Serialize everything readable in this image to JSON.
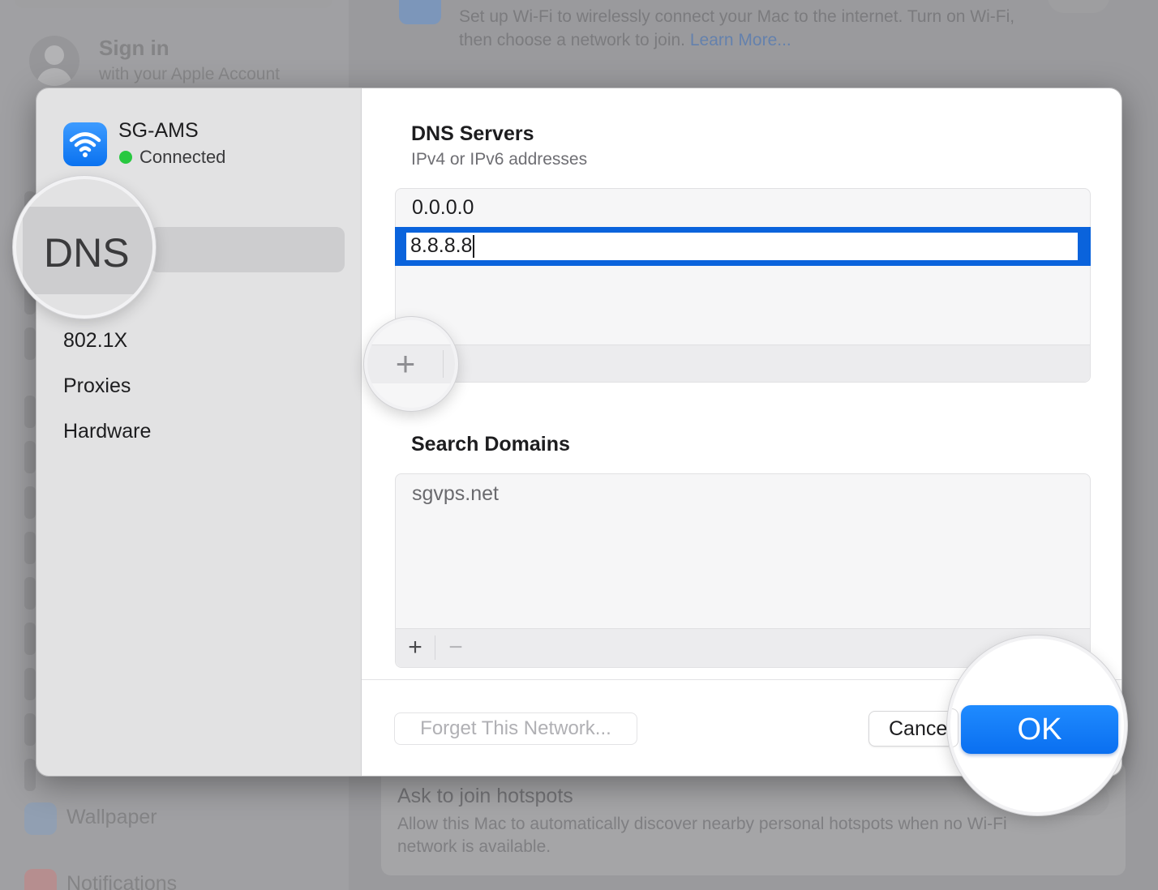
{
  "background": {
    "account": {
      "title": "Sign in",
      "subtitle": "with your Apple Account"
    },
    "wifi_description": "Set up Wi-Fi to wirelessly connect your Mac to the internet. Turn on Wi-Fi, then choose a network to join.",
    "learn_more": "Learn More...",
    "sidebar_items": {
      "wallpaper": "Wallpaper",
      "notifications": "Notifications"
    },
    "hotspot": {
      "title": "Ask to join hotspots",
      "description": "Allow this Mac to automatically discover nearby personal hotspots when no Wi-Fi network is available."
    }
  },
  "sheet": {
    "network": {
      "name": "SG-AMS",
      "status": "Connected",
      "status_color": "#28c840"
    },
    "nav": {
      "selected": "DNS",
      "items": [
        "802.1X",
        "Proxies",
        "Hardware"
      ]
    },
    "dns_servers": {
      "title": "DNS Servers",
      "subtitle": "IPv4 or IPv6 addresses",
      "entries": [
        "0.0.0.0",
        "8.8.8.8"
      ],
      "add_symbol": "+"
    },
    "search_domains": {
      "title": "Search Domains",
      "entries": [
        "sgvps.net"
      ],
      "add_symbol": "+",
      "remove_symbol": "−"
    },
    "buttons": {
      "forget": "Forget This Network...",
      "cancel": "Cancel",
      "ok": "OK"
    }
  },
  "colors": {
    "accent": "#0a72f0",
    "selection": "#0a63dc"
  }
}
